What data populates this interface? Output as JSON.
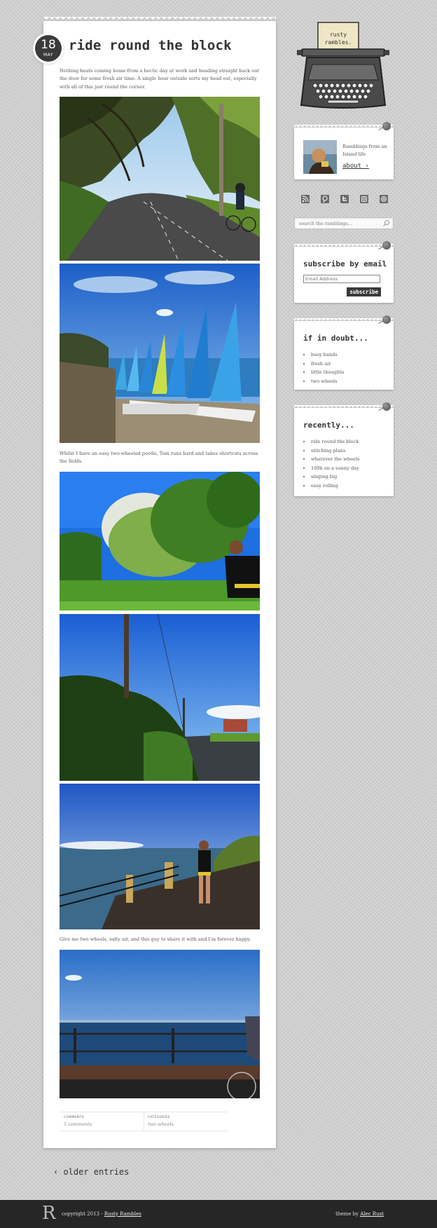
{
  "post": {
    "date_day": "18",
    "date_month": "MAY",
    "title": "ride round the block",
    "intro": "Nothing beats coming home from a hectic day at work and heading straight back out the door for some fresh air time. A single hour outside sorts my head out, especially with all of this just round the corner.",
    "caption_1": "Whilst I have an easy two-wheeled pootle, Tom runs hard and takes shortcuts across the fields.",
    "caption_2": "Give me two wheels, salty air, and this guy to share it with and I'm forever happy.",
    "meta": {
      "comments_label": "COMMENTS",
      "comments_value": "5 comments",
      "categories_label": "CATEGORIES",
      "categories_value": "two wheels"
    }
  },
  "pagination": {
    "older_label": "‹ older entries"
  },
  "sidebar": {
    "logo_text": "rusty rambles.",
    "about": {
      "text": "Ramblings from an Island life",
      "link": "about ›"
    },
    "social_icons": [
      "rss-icon",
      "pinterest-icon",
      "twitter-icon",
      "instagram-icon",
      "email-icon"
    ],
    "search": {
      "placeholder": "search the ramblings..."
    },
    "subscribe": {
      "title": "subscribe by email",
      "email_placeholder": "Email Address",
      "button": "subscribe"
    },
    "if_in_doubt": {
      "title": "if in doubt...",
      "items": [
        "busy hands",
        "fresh air",
        "little thoughts",
        "two wheels"
      ]
    },
    "recently": {
      "title": "recently...",
      "items": [
        "ride round the block",
        "stitching plans",
        "whatever the wheels",
        "100k on a sunny day",
        "singing big",
        "easy rolling"
      ]
    }
  },
  "footer": {
    "logo_letter": "R",
    "copyright": "copyright 2013 - ",
    "site_name": "Rusty Rambles",
    "theme_prefix": "theme by ",
    "theme_author": "Alec Rust"
  }
}
